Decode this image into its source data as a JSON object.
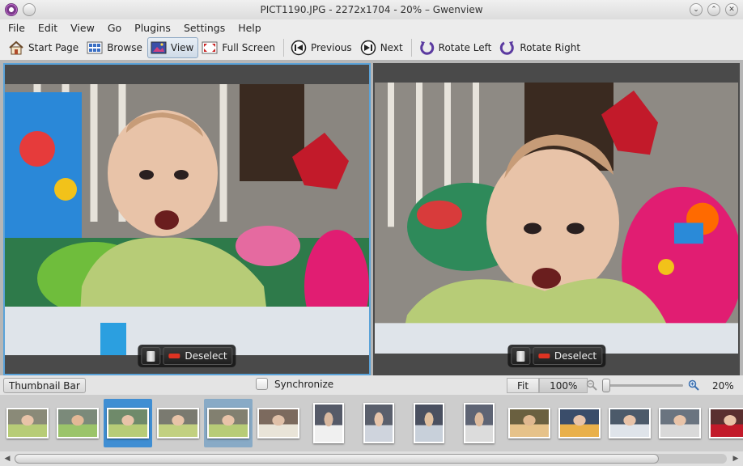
{
  "window": {
    "title": "PICT1190.JPG - 2272x1704 - 20% – Gwenview"
  },
  "menu": [
    "File",
    "Edit",
    "View",
    "Go",
    "Plugins",
    "Settings",
    "Help"
  ],
  "toolbar": {
    "start_page": "Start Page",
    "browse": "Browse",
    "view": "View",
    "full_screen": "Full Screen",
    "previous": "Previous",
    "next": "Next",
    "rotate_left": "Rotate Left",
    "rotate_right": "Rotate Right"
  },
  "viewer": {
    "deselect_label": "Deselect"
  },
  "statusbar": {
    "thumbnail_bar": "Thumbnail Bar",
    "synchronize": "Synchronize",
    "fit": "Fit",
    "zoom_100": "100%",
    "zoom_level": "20%",
    "synchronize_checked": false
  },
  "thumbnails": {
    "count": 15,
    "selected_indices": [
      2,
      4
    ],
    "current_index": 2
  },
  "colors": {
    "selection_accent": "#3f8ed3",
    "active_pane_border": "#5aa2d8"
  }
}
